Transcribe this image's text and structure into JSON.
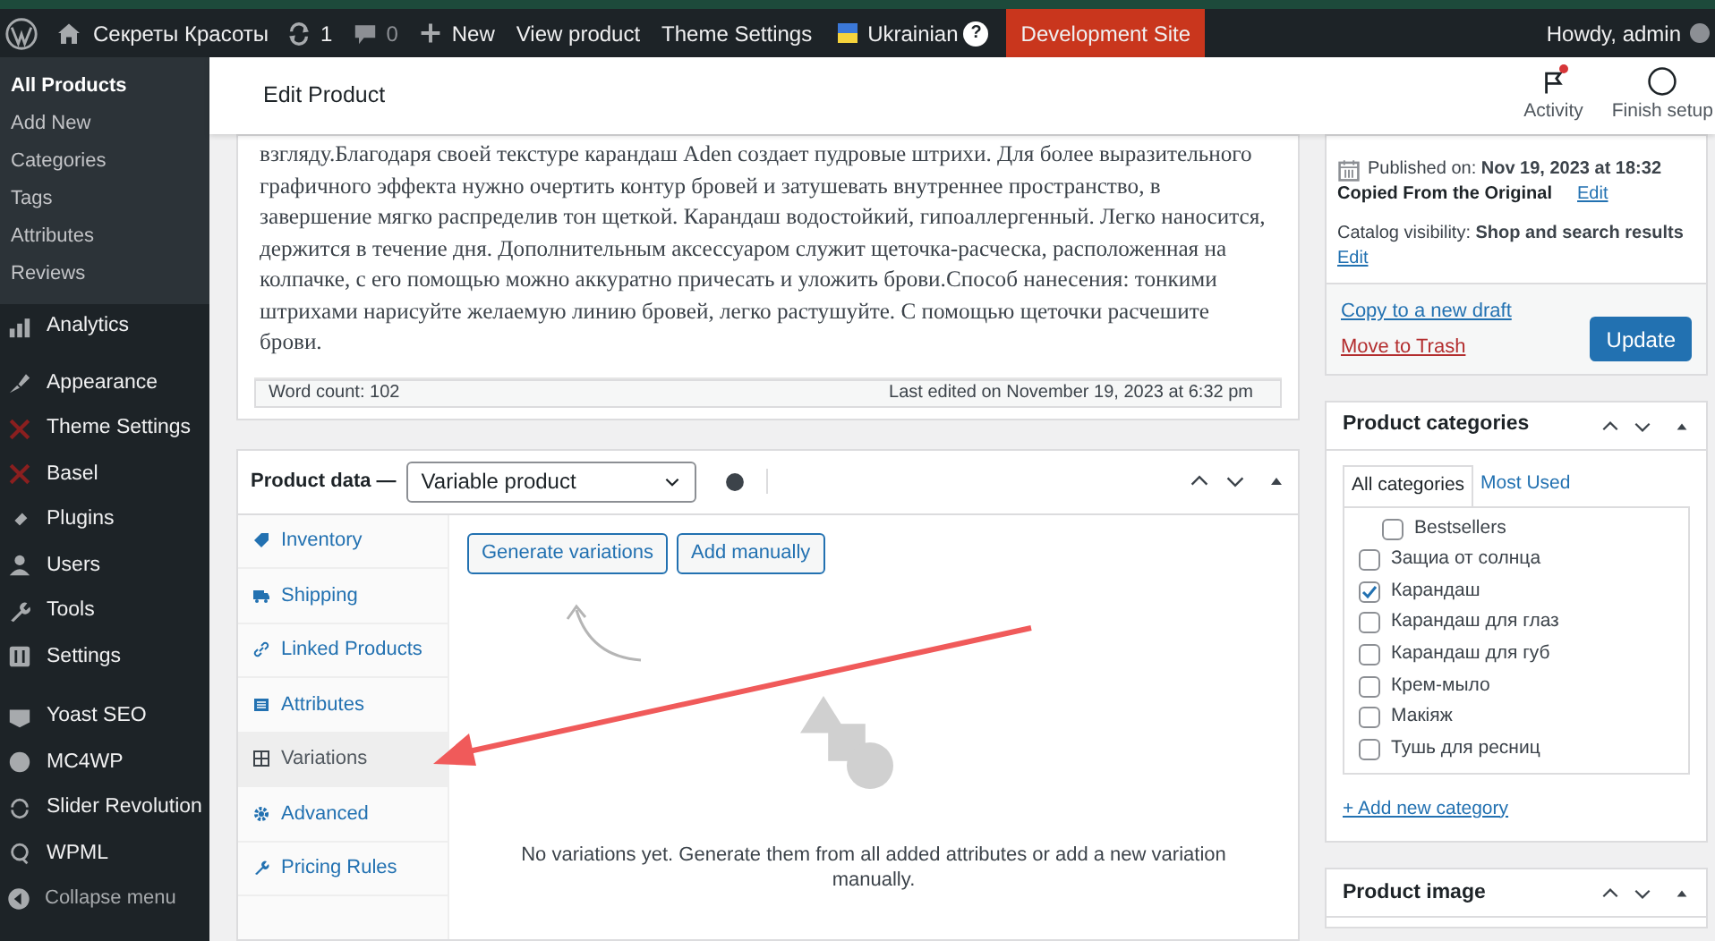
{
  "admin_bar": {
    "site_name": "Секреты Красоты",
    "updates": "1",
    "comments": "0",
    "new": "New",
    "links": [
      "View product",
      "Theme Settings"
    ],
    "language": "Ukrainian",
    "help": "?",
    "dev_site": "Development Site",
    "greeting": "Howdy, admin"
  },
  "sidebar": {
    "submenu": [
      {
        "label": "All Products",
        "selected": true
      },
      {
        "label": "Add New",
        "selected": false
      },
      {
        "label": "Categories",
        "selected": false
      },
      {
        "label": "Tags",
        "selected": false
      },
      {
        "label": "Attributes",
        "selected": false
      },
      {
        "label": "Reviews",
        "selected": false
      }
    ],
    "items": [
      {
        "label": "Analytics"
      },
      {
        "label": "Appearance"
      },
      {
        "label": "Theme Settings"
      },
      {
        "label": "Basel"
      },
      {
        "label": "Plugins"
      },
      {
        "label": "Users"
      },
      {
        "label": "Tools"
      },
      {
        "label": "Settings"
      },
      {
        "label": "Yoast SEO"
      },
      {
        "label": "MC4WP"
      },
      {
        "label": "Slider Revolution"
      },
      {
        "label": "WPML"
      }
    ],
    "collapse": "Collapse menu"
  },
  "header": {
    "title": "Edit Product",
    "actions": [
      {
        "label": "Activity",
        "notification": true
      },
      {
        "label": "Finish setup",
        "notification": false
      }
    ]
  },
  "editor": {
    "text": "взгляду.Благодаря своей текстуре карандаш Aden создает пудровые штрихи. Для более выразительного графичного эффекта нужно очертить контур бровей и затушевать внутреннее пространство, в завершение мягко распределив тон щеткой. Карандаш водостойкий, гипоаллергенный. Легко наносится, держится в течение дня. Дополнительным аксессуаром служит щеточка-расческа, расположенная на колпачке, с его помощью можно аккуратно причесать и уложить брови.Способ нанесения: тонкими штрихами нарисуйте желаемую линию бровей, легко растушуйте. С помощью щеточки расчешите брови.",
    "word_count": "Word count: 102",
    "last_edited": "Last edited on November 19, 2023 at 6:32 pm"
  },
  "product_data": {
    "label": "Product data —",
    "type": "Variable product",
    "tabs": [
      {
        "label": "Inventory",
        "selected": false
      },
      {
        "label": "Shipping",
        "selected": false
      },
      {
        "label": "Linked Products",
        "selected": false
      },
      {
        "label": "Attributes",
        "selected": false
      },
      {
        "label": "Variations",
        "selected": true
      },
      {
        "label": "Advanced",
        "selected": false
      },
      {
        "label": "Pricing Rules",
        "selected": false
      }
    ],
    "buttons": [
      "Generate variations",
      "Add manually"
    ],
    "empty_message": "No variations yet. Generate them from all added attributes or add a new variation manually."
  },
  "publish": {
    "published_label": "Published on:",
    "published_date": "Nov 19, 2023 at 18:32",
    "copied": "Copied From the Original",
    "copied_edit": "Edit",
    "visibility_label": "Catalog visibility:",
    "visibility": "Shop and search results",
    "visibility_edit": "Edit",
    "copy_draft": "Copy to a new draft",
    "trash": "Move to Trash",
    "update": "Update"
  },
  "categories": {
    "title": "Product categories",
    "tabs": [
      {
        "label": "All categories",
        "selected": true
      },
      {
        "label": "Most Used",
        "selected": false
      }
    ],
    "items": [
      {
        "label": "Bestsellers",
        "checked": false,
        "kind": "sub"
      },
      {
        "label": "Защиа от солнца",
        "checked": false,
        "kind": "top"
      },
      {
        "label": "Карандаш",
        "checked": true,
        "kind": "top"
      },
      {
        "label": "Карандаш для глаз",
        "checked": false,
        "kind": "top"
      },
      {
        "label": "Карандаш для губ",
        "checked": false,
        "kind": "top"
      },
      {
        "label": "Крем-мыло",
        "checked": false,
        "kind": "top"
      },
      {
        "label": "Макіяж",
        "checked": false,
        "kind": "top"
      },
      {
        "label": "Тушь для ресниц",
        "checked": false,
        "kind": "top"
      }
    ],
    "add_new": "+ Add new category"
  },
  "product_image": {
    "title": "Product image"
  }
}
